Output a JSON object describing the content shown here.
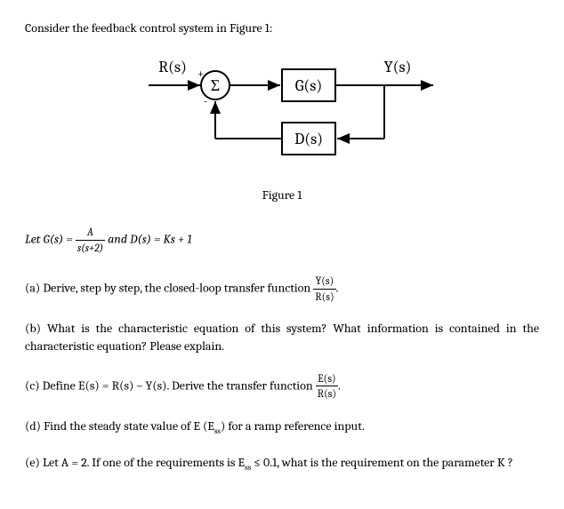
{
  "intro": "Consider the feedback control system in Figure 1:",
  "figure": {
    "input_label": "R(s)",
    "output_label": "Y(s)",
    "sum_label": "Σ",
    "plus": "+",
    "minus": "-",
    "block_G": "G(s)",
    "block_D": "D(s)",
    "caption": "Figure 1"
  },
  "definition": {
    "prefix": "Let G(s) = ",
    "G_num": "A",
    "G_den": "s(s+2)",
    "mid": " and D(s) =  Ks + 1",
    "suffix": ""
  },
  "qa": {
    "prefix": "(a) Derive, step by step, the closed-loop transfer function ",
    "frac_num": "Y(s)",
    "frac_den": "R(s)",
    "suffix": "."
  },
  "qb": "(b) What is the characteristic equation of this system? What information is contained in the characteristic equation? Please explain.",
  "qc": {
    "prefix": "(c) Define E(s) = R(s) – Y(s). Derive the transfer function ",
    "frac_num": "E(s)",
    "frac_den": "R(s)",
    "suffix": "."
  },
  "qd": {
    "prefix": "(d) Find the steady state value of E (E",
    "sub": "ss",
    "suffix": ") for a ramp reference input."
  },
  "qe": {
    "prefix": "(e) Let A = 2. If one of the requirements is E",
    "sub": "ss",
    "mid": " ≤ 0.1, what is the requirement on the parameter K ?"
  }
}
